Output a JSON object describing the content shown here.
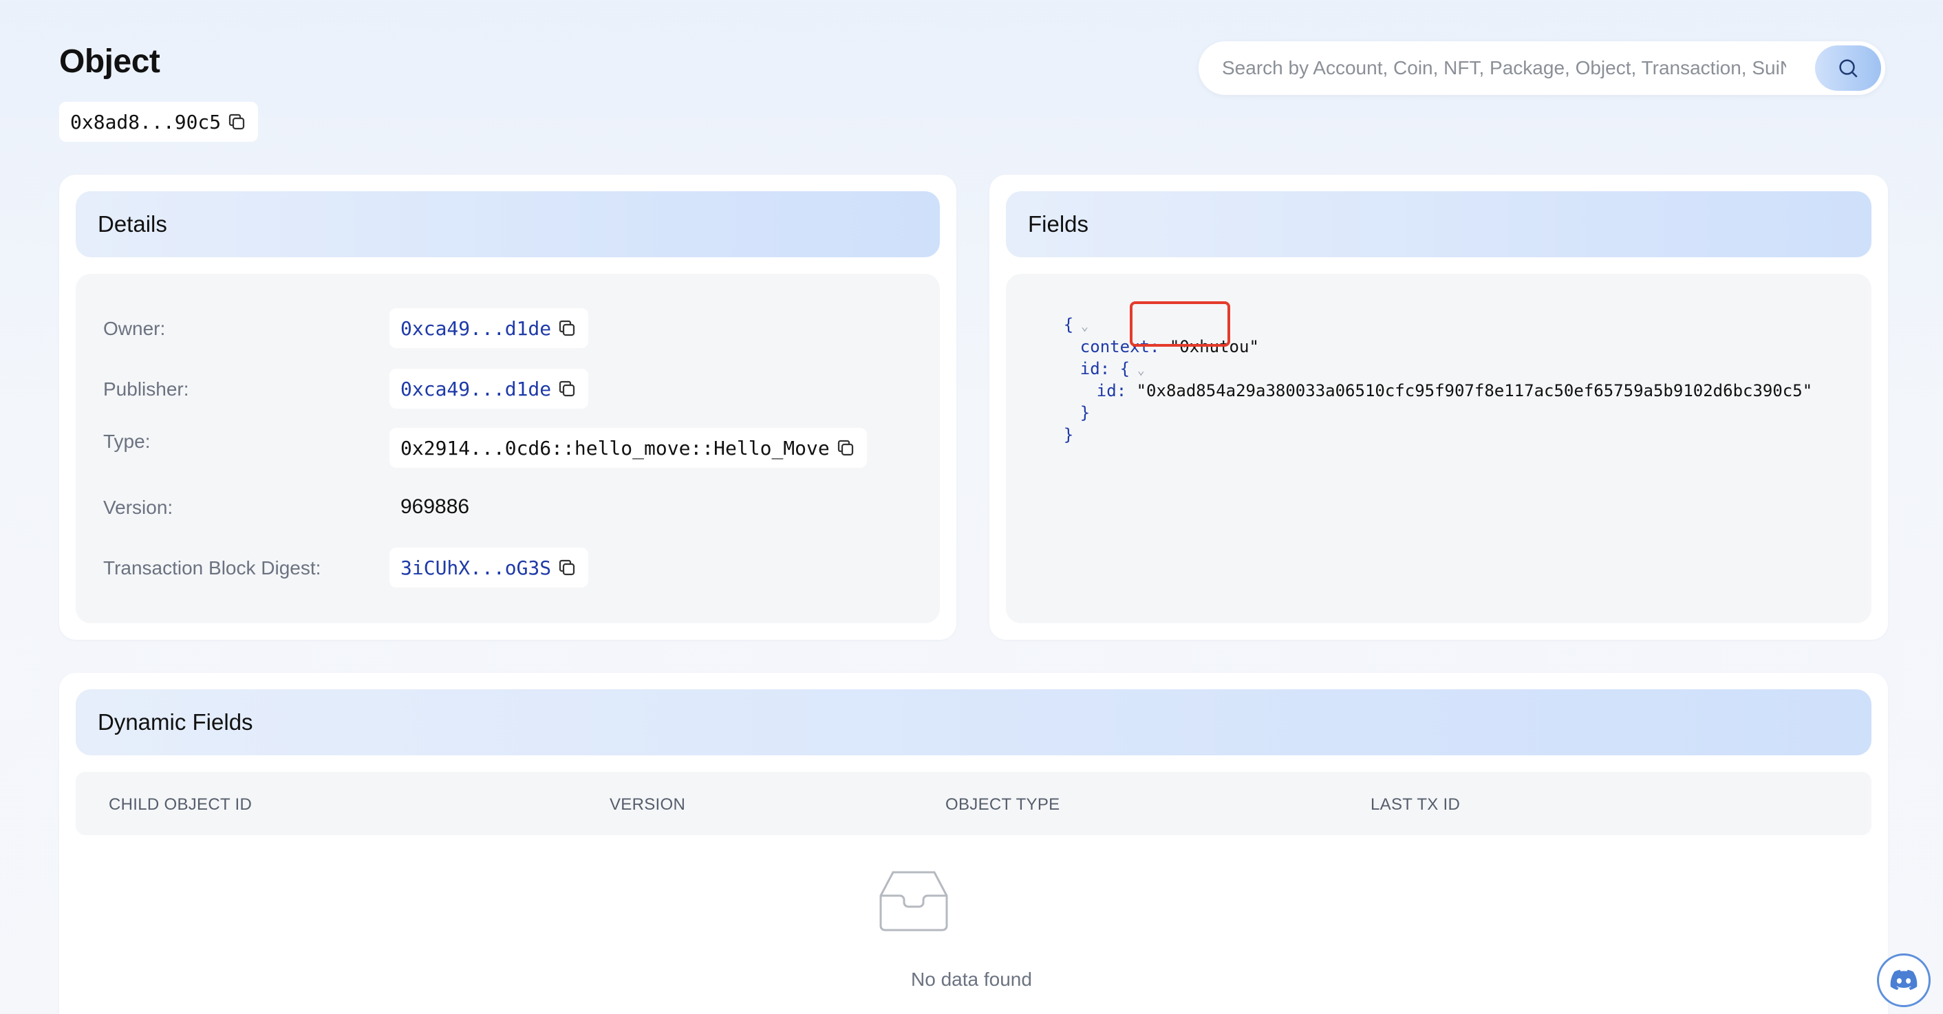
{
  "page": {
    "title": "Object",
    "object_id_short": "0x8ad8...90c5"
  },
  "search": {
    "placeholder": "Search by Account, Coin, NFT, Package, Object, Transaction, SuiNS"
  },
  "details": {
    "title": "Details",
    "owner_label": "Owner:",
    "owner_value": "0xca49...d1de",
    "publisher_label": "Publisher:",
    "publisher_value": "0xca49...d1de",
    "type_label": "Type:",
    "type_value": "0x2914...0cd6::hello_move::Hello_Move",
    "version_label": "Version:",
    "version_value": "969886",
    "digest_label": "Transaction Block Digest:",
    "digest_value": "3iCUhX...oG3S"
  },
  "fields": {
    "title": "Fields",
    "open_brace": "{",
    "context_key": "context:",
    "context_value": "\"0xhutou\"",
    "id_key": "id:",
    "id_open": "{",
    "inner_id_key": "id:",
    "inner_id_value": "\"0x8ad854a29a380033a06510cfc95f907f8e117ac50ef65759a5b9102d6bc390c5\"",
    "inner_close": "}",
    "close_brace": "}"
  },
  "dynamic_fields": {
    "title": "Dynamic Fields",
    "columns": [
      "CHILD OBJECT ID",
      "VERSION",
      "OBJECT TYPE",
      "LAST TX ID"
    ],
    "empty_text": "No data found"
  },
  "colors": {
    "accent": "#1e3aa8",
    "highlight": "#e53b2c"
  },
  "icons": {
    "copy": "copy-icon",
    "search": "search-icon",
    "empty": "empty-inbox-icon",
    "discord": "discord-icon"
  }
}
